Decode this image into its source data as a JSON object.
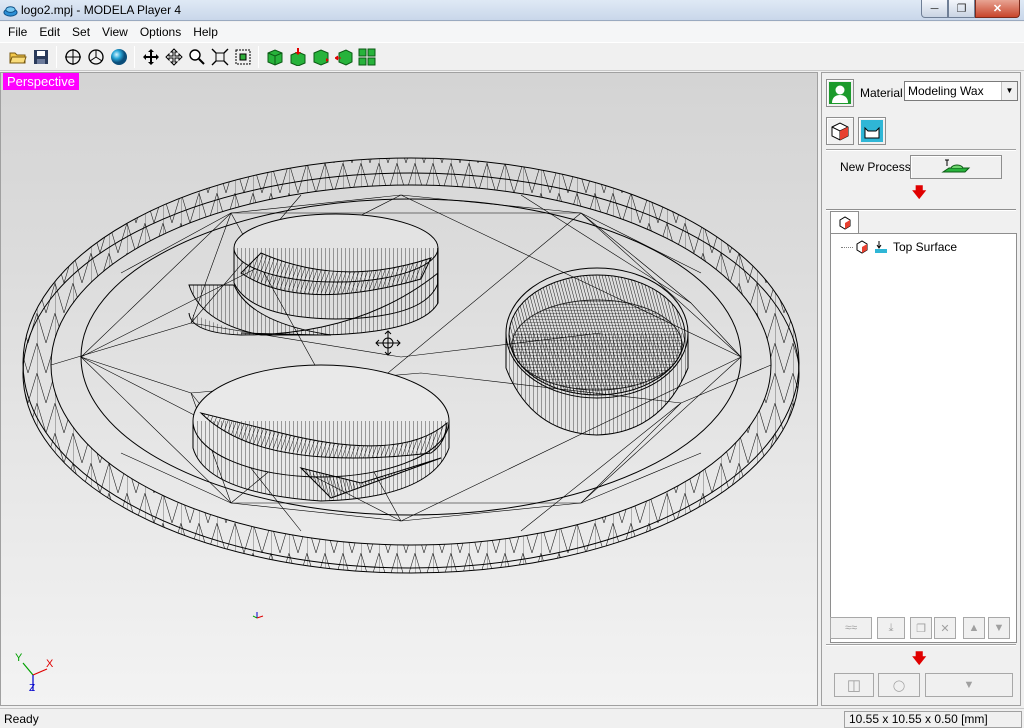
{
  "window": {
    "title": "logo2.mpj - MODELA Player 4",
    "controls": [
      "minimize",
      "restore",
      "close"
    ]
  },
  "menu": [
    "File",
    "Edit",
    "Set",
    "View",
    "Options",
    "Help"
  ],
  "toolbar": {
    "groups": [
      [
        "open-folder-icon",
        "save-icon"
      ],
      [
        "view-top-icon",
        "view-front-icon",
        "view-render-sphere-icon"
      ],
      [
        "pan-icon",
        "move-icon",
        "zoom-icon",
        "fit-icon",
        "zoom-box-icon"
      ],
      [
        "cube-green-icon",
        "cube-down-icon",
        "cube-rotate-icon",
        "cube-left-icon",
        "layout-icon"
      ]
    ]
  },
  "viewport": {
    "mode_label": "Perspective",
    "axes": {
      "y": "Y",
      "x": "X",
      "z": "Z"
    }
  },
  "panel": {
    "material_label": "Material",
    "material_value": "Modeling Wax",
    "new_process_label": "New Process",
    "process_tree": [
      {
        "label": "Top Surface"
      }
    ]
  },
  "status": {
    "text": "Ready",
    "dimensions": "10.55 x 10.55 x 0.50 [mm]"
  },
  "colors": {
    "view_label_bg": "#ff00ff",
    "arrow_red": "#e00000",
    "axis_x": "#e00000",
    "axis_y": "#00a000",
    "axis_z": "#0000cc"
  }
}
